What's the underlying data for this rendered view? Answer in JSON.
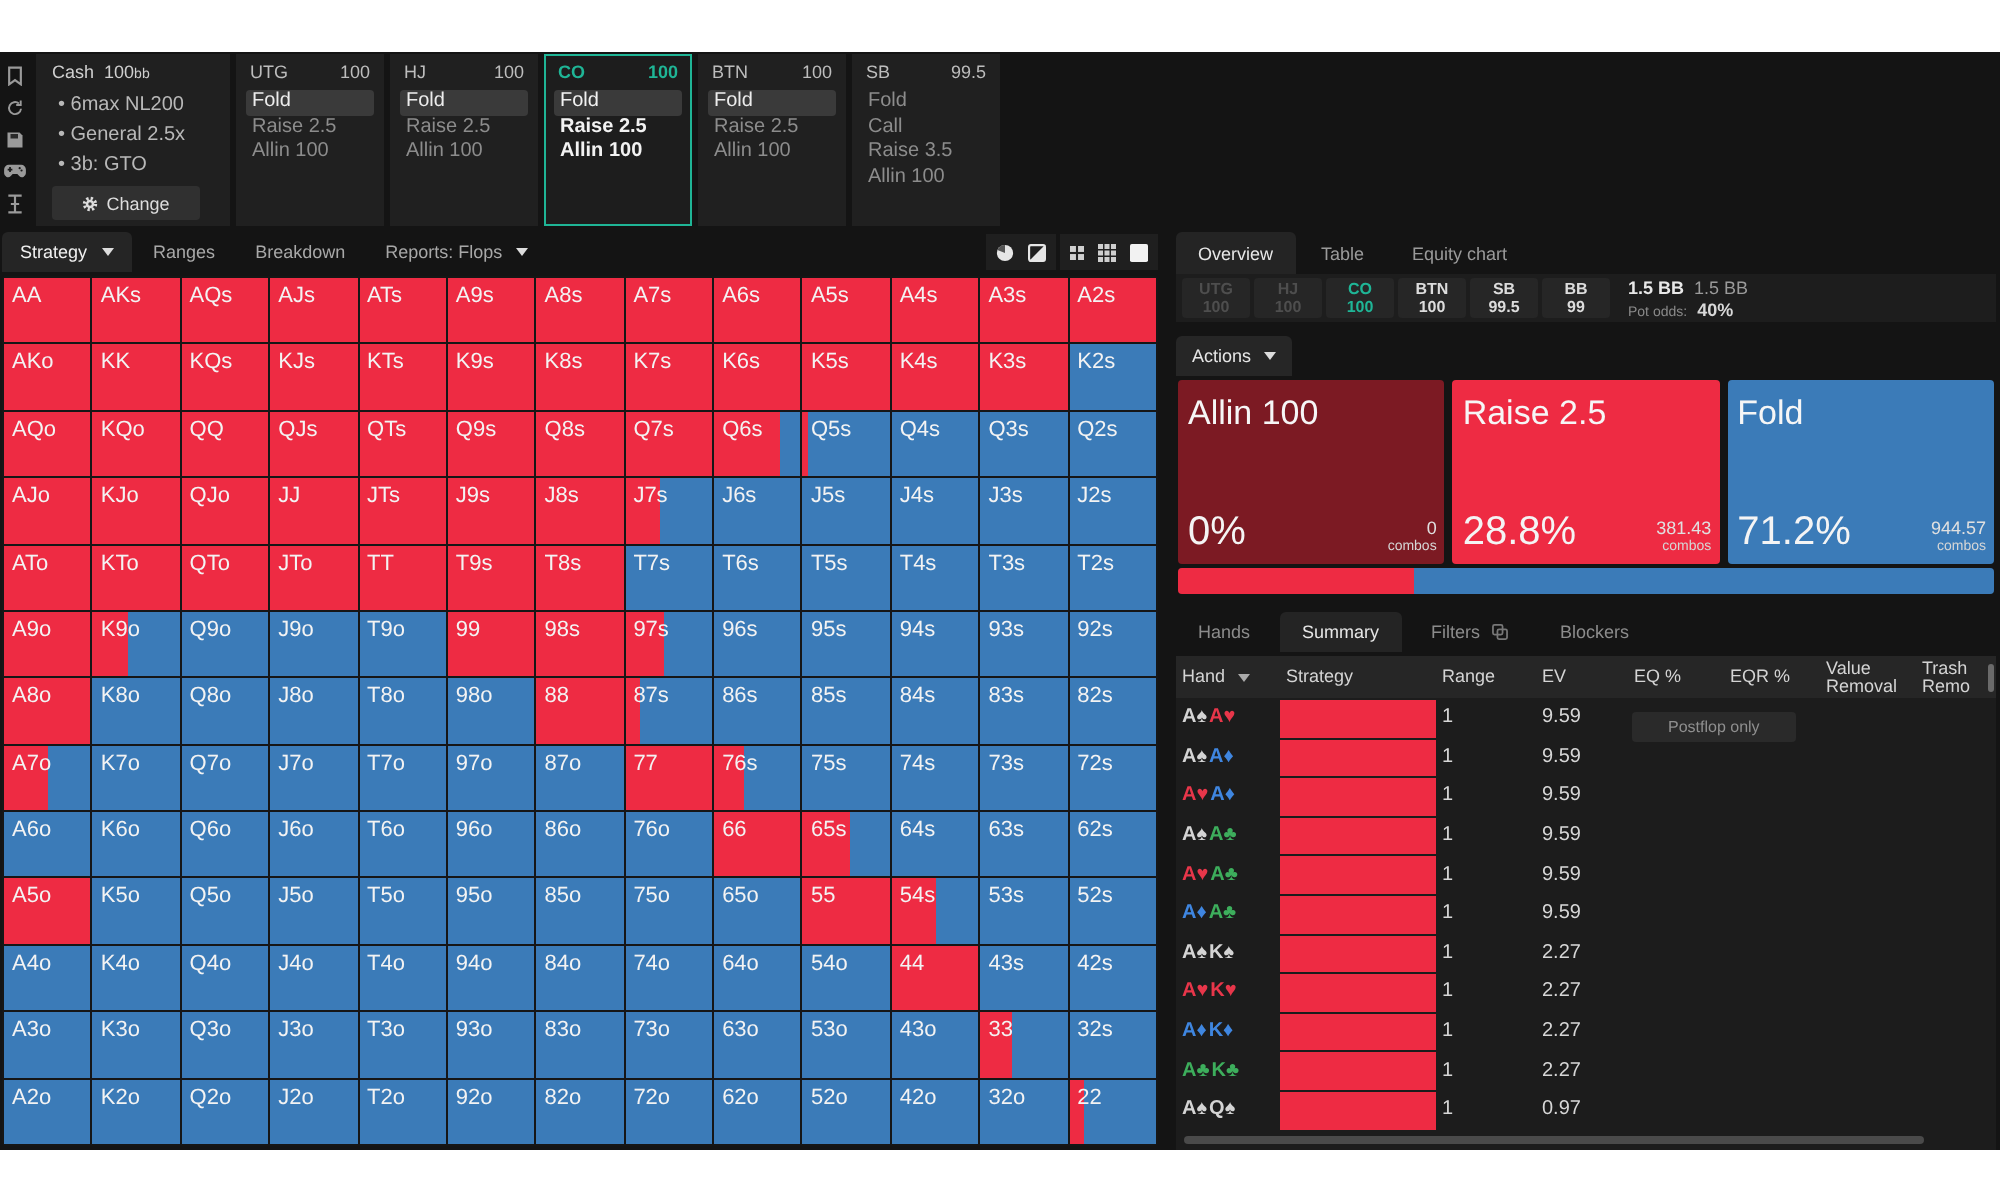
{
  "game": {
    "type": "Cash",
    "stack": "100",
    "unit": "bb",
    "details": [
      "• 6max NL200",
      "• General 2.5x",
      "• 3b: GTO"
    ],
    "button": "Change"
  },
  "positions": [
    {
      "name": "UTG",
      "stack": "100",
      "active": false,
      "actions": [
        {
          "label": "Fold",
          "selected": true
        },
        {
          "label": "Raise 2.5",
          "selected": false
        },
        {
          "label": "Allin 100",
          "selected": false
        }
      ]
    },
    {
      "name": "HJ",
      "stack": "100",
      "active": false,
      "actions": [
        {
          "label": "Fold",
          "selected": true
        },
        {
          "label": "Raise 2.5",
          "selected": false
        },
        {
          "label": "Allin 100",
          "selected": false
        }
      ]
    },
    {
      "name": "CO",
      "stack": "100",
      "active": true,
      "actions": [
        {
          "label": "Fold",
          "selected": true
        },
        {
          "label": "Raise 2.5",
          "selected": false
        },
        {
          "label": "Allin 100",
          "selected": false
        }
      ]
    },
    {
      "name": "BTN",
      "stack": "100",
      "active": false,
      "actions": [
        {
          "label": "Fold",
          "selected": true
        },
        {
          "label": "Raise 2.5",
          "selected": false
        },
        {
          "label": "Allin 100",
          "selected": false
        }
      ]
    },
    {
      "name": "SB",
      "stack": "99.5",
      "active": false,
      "actions": [
        {
          "label": "Fold",
          "selected": false
        },
        {
          "label": "Call",
          "selected": false
        },
        {
          "label": "Raise 3.5",
          "selected": false
        },
        {
          "label": "Allin 100",
          "selected": false
        }
      ]
    }
  ],
  "view_tabs": [
    {
      "label": "Strategy",
      "selected": true,
      "dropdown": true
    },
    {
      "label": "Ranges",
      "selected": false,
      "dropdown": false
    },
    {
      "label": "Breakdown",
      "selected": false,
      "dropdown": false
    },
    {
      "label": "Reports: Flops",
      "selected": false,
      "dropdown": true
    }
  ],
  "grid": {
    "rows": [
      [
        {
          "hand": "AA",
          "kind": "raise"
        },
        {
          "hand": "AKs",
          "kind": "raise"
        },
        {
          "hand": "AQs",
          "kind": "raise"
        },
        {
          "hand": "AJs",
          "kind": "raise"
        },
        {
          "hand": "ATs",
          "kind": "raise"
        },
        {
          "hand": "A9s",
          "kind": "raise"
        },
        {
          "hand": "A8s",
          "kind": "raise"
        },
        {
          "hand": "A7s",
          "kind": "raise"
        },
        {
          "hand": "A6s",
          "kind": "raise"
        },
        {
          "hand": "A5s",
          "kind": "raise"
        },
        {
          "hand": "A4s",
          "kind": "raise"
        },
        {
          "hand": "A3s",
          "kind": "raise"
        },
        {
          "hand": "A2s",
          "kind": "raise"
        }
      ],
      [
        {
          "hand": "AKo",
          "kind": "raise"
        },
        {
          "hand": "KK",
          "kind": "raise"
        },
        {
          "hand": "KQs",
          "kind": "raise"
        },
        {
          "hand": "KJs",
          "kind": "raise"
        },
        {
          "hand": "KTs",
          "kind": "raise"
        },
        {
          "hand": "K9s",
          "kind": "raise"
        },
        {
          "hand": "K8s",
          "kind": "raise"
        },
        {
          "hand": "K7s",
          "kind": "raise"
        },
        {
          "hand": "K6s",
          "kind": "raise"
        },
        {
          "hand": "K5s",
          "kind": "raise"
        },
        {
          "hand": "K4s",
          "kind": "raise"
        },
        {
          "hand": "K3s",
          "kind": "raise"
        },
        {
          "hand": "K2s",
          "kind": "fold"
        }
      ],
      [
        {
          "hand": "AQo",
          "kind": "raise"
        },
        {
          "hand": "KQo",
          "kind": "raise"
        },
        {
          "hand": "QQ",
          "kind": "raise"
        },
        {
          "hand": "QJs",
          "kind": "raise"
        },
        {
          "hand": "QTs",
          "kind": "raise"
        },
        {
          "hand": "Q9s",
          "kind": "raise"
        },
        {
          "hand": "Q8s",
          "kind": "raise"
        },
        {
          "hand": "Q7s",
          "kind": "raise"
        },
        {
          "hand": "Q6s",
          "kind": "mixed",
          "level": 0.75
        },
        {
          "hand": "Q5s",
          "kind": "mixed",
          "level": 0.05
        },
        {
          "hand": "Q4s",
          "kind": "fold"
        },
        {
          "hand": "Q3s",
          "kind": "fold"
        },
        {
          "hand": "Q2s",
          "kind": "fold"
        }
      ],
      [
        {
          "hand": "AJo",
          "kind": "raise"
        },
        {
          "hand": "KJo",
          "kind": "raise"
        },
        {
          "hand": "QJo",
          "kind": "raise"
        },
        {
          "hand": "JJ",
          "kind": "raise"
        },
        {
          "hand": "JTs",
          "kind": "raise"
        },
        {
          "hand": "J9s",
          "kind": "raise"
        },
        {
          "hand": "J8s",
          "kind": "raise"
        },
        {
          "hand": "J7s",
          "kind": "mixed",
          "level": 0.4
        },
        {
          "hand": "J6s",
          "kind": "fold"
        },
        {
          "hand": "J5s",
          "kind": "fold"
        },
        {
          "hand": "J4s",
          "kind": "fold"
        },
        {
          "hand": "J3s",
          "kind": "fold"
        },
        {
          "hand": "J2s",
          "kind": "fold"
        }
      ],
      [
        {
          "hand": "ATo",
          "kind": "raise"
        },
        {
          "hand": "KTo",
          "kind": "raise"
        },
        {
          "hand": "QTo",
          "kind": "raise"
        },
        {
          "hand": "JTo",
          "kind": "raise"
        },
        {
          "hand": "TT",
          "kind": "raise"
        },
        {
          "hand": "T9s",
          "kind": "raise"
        },
        {
          "hand": "T8s",
          "kind": "raise"
        },
        {
          "hand": "T7s",
          "kind": "fold"
        },
        {
          "hand": "T6s",
          "kind": "fold"
        },
        {
          "hand": "T5s",
          "kind": "fold"
        },
        {
          "hand": "T4s",
          "kind": "fold"
        },
        {
          "hand": "T3s",
          "kind": "fold"
        },
        {
          "hand": "T2s",
          "kind": "fold"
        }
      ],
      [
        {
          "hand": "A9o",
          "kind": "raise"
        },
        {
          "hand": "K9o",
          "kind": "mixed",
          "level": 0.4
        },
        {
          "hand": "Q9o",
          "kind": "fold"
        },
        {
          "hand": "J9o",
          "kind": "fold"
        },
        {
          "hand": "T9o",
          "kind": "fold"
        },
        {
          "hand": "99",
          "kind": "raise"
        },
        {
          "hand": "98s",
          "kind": "raise"
        },
        {
          "hand": "97s",
          "kind": "mixed",
          "level": 0.45
        },
        {
          "hand": "96s",
          "kind": "fold"
        },
        {
          "hand": "95s",
          "kind": "fold"
        },
        {
          "hand": "94s",
          "kind": "fold"
        },
        {
          "hand": "93s",
          "kind": "fold"
        },
        {
          "hand": "92s",
          "kind": "fold"
        }
      ],
      [
        {
          "hand": "A8o",
          "kind": "raise"
        },
        {
          "hand": "K8o",
          "kind": "fold"
        },
        {
          "hand": "Q8o",
          "kind": "fold"
        },
        {
          "hand": "J8o",
          "kind": "fold"
        },
        {
          "hand": "T8o",
          "kind": "fold"
        },
        {
          "hand": "98o",
          "kind": "fold"
        },
        {
          "hand": "88",
          "kind": "raise"
        },
        {
          "hand": "87s",
          "kind": "mixed",
          "level": 0.17
        },
        {
          "hand": "86s",
          "kind": "fold"
        },
        {
          "hand": "85s",
          "kind": "fold"
        },
        {
          "hand": "84s",
          "kind": "fold"
        },
        {
          "hand": "83s",
          "kind": "fold"
        },
        {
          "hand": "82s",
          "kind": "fold"
        }
      ],
      [
        {
          "hand": "A7o",
          "kind": "mixed",
          "level": 0.5
        },
        {
          "hand": "K7o",
          "kind": "fold"
        },
        {
          "hand": "Q7o",
          "kind": "fold"
        },
        {
          "hand": "J7o",
          "kind": "fold"
        },
        {
          "hand": "T7o",
          "kind": "fold"
        },
        {
          "hand": "97o",
          "kind": "fold"
        },
        {
          "hand": "87o",
          "kind": "fold"
        },
        {
          "hand": "77",
          "kind": "raise"
        },
        {
          "hand": "76s",
          "kind": "mixed",
          "level": 0.35
        },
        {
          "hand": "75s",
          "kind": "fold"
        },
        {
          "hand": "74s",
          "kind": "fold"
        },
        {
          "hand": "73s",
          "kind": "fold"
        },
        {
          "hand": "72s",
          "kind": "fold"
        }
      ],
      [
        {
          "hand": "A6o",
          "kind": "fold"
        },
        {
          "hand": "K6o",
          "kind": "fold"
        },
        {
          "hand": "Q6o",
          "kind": "fold"
        },
        {
          "hand": "J6o",
          "kind": "fold"
        },
        {
          "hand": "T6o",
          "kind": "fold"
        },
        {
          "hand": "96o",
          "kind": "fold"
        },
        {
          "hand": "86o",
          "kind": "fold"
        },
        {
          "hand": "76o",
          "kind": "fold"
        },
        {
          "hand": "66",
          "kind": "raise"
        },
        {
          "hand": "65s",
          "kind": "mixed",
          "level": 0.55
        },
        {
          "hand": "64s",
          "kind": "fold"
        },
        {
          "hand": "63s",
          "kind": "fold"
        },
        {
          "hand": "62s",
          "kind": "fold"
        }
      ],
      [
        {
          "hand": "A5o",
          "kind": "raise"
        },
        {
          "hand": "K5o",
          "kind": "fold"
        },
        {
          "hand": "Q5o",
          "kind": "fold"
        },
        {
          "hand": "J5o",
          "kind": "fold"
        },
        {
          "hand": "T5o",
          "kind": "fold"
        },
        {
          "hand": "95o",
          "kind": "fold"
        },
        {
          "hand": "85o",
          "kind": "fold"
        },
        {
          "hand": "75o",
          "kind": "fold"
        },
        {
          "hand": "65o",
          "kind": "fold"
        },
        {
          "hand": "55",
          "kind": "raise"
        },
        {
          "hand": "54s",
          "kind": "mixed",
          "level": 0.5
        },
        {
          "hand": "53s",
          "kind": "fold"
        },
        {
          "hand": "52s",
          "kind": "fold"
        }
      ],
      [
        {
          "hand": "A4o",
          "kind": "fold"
        },
        {
          "hand": "K4o",
          "kind": "fold"
        },
        {
          "hand": "Q4o",
          "kind": "fold"
        },
        {
          "hand": "J4o",
          "kind": "fold"
        },
        {
          "hand": "T4o",
          "kind": "fold"
        },
        {
          "hand": "94o",
          "kind": "fold"
        },
        {
          "hand": "84o",
          "kind": "fold"
        },
        {
          "hand": "74o",
          "kind": "fold"
        },
        {
          "hand": "64o",
          "kind": "fold"
        },
        {
          "hand": "54o",
          "kind": "fold"
        },
        {
          "hand": "44",
          "kind": "raise"
        },
        {
          "hand": "43s",
          "kind": "fold"
        },
        {
          "hand": "42s",
          "kind": "fold"
        }
      ],
      [
        {
          "hand": "A3o",
          "kind": "fold"
        },
        {
          "hand": "K3o",
          "kind": "fold"
        },
        {
          "hand": "Q3o",
          "kind": "fold"
        },
        {
          "hand": "J3o",
          "kind": "fold"
        },
        {
          "hand": "T3o",
          "kind": "fold"
        },
        {
          "hand": "93o",
          "kind": "fold"
        },
        {
          "hand": "83o",
          "kind": "fold"
        },
        {
          "hand": "73o",
          "kind": "fold"
        },
        {
          "hand": "63o",
          "kind": "fold"
        },
        {
          "hand": "53o",
          "kind": "fold"
        },
        {
          "hand": "43o",
          "kind": "fold"
        },
        {
          "hand": "33",
          "kind": "mixed",
          "level": 0.37
        },
        {
          "hand": "32s",
          "kind": "fold"
        }
      ],
      [
        {
          "hand": "A2o",
          "kind": "fold"
        },
        {
          "hand": "K2o",
          "kind": "fold"
        },
        {
          "hand": "Q2o",
          "kind": "fold"
        },
        {
          "hand": "J2o",
          "kind": "fold"
        },
        {
          "hand": "T2o",
          "kind": "fold"
        },
        {
          "hand": "92o",
          "kind": "fold"
        },
        {
          "hand": "82o",
          "kind": "fold"
        },
        {
          "hand": "72o",
          "kind": "fold"
        },
        {
          "hand": "62o",
          "kind": "fold"
        },
        {
          "hand": "52o",
          "kind": "fold"
        },
        {
          "hand": "42o",
          "kind": "fold"
        },
        {
          "hand": "32o",
          "kind": "fold"
        },
        {
          "hand": "22",
          "kind": "mixed",
          "level": 0.16
        }
      ]
    ]
  },
  "panel_tabs": [
    {
      "label": "Overview",
      "selected": true
    },
    {
      "label": "Table",
      "selected": false
    },
    {
      "label": "Equity chart",
      "selected": false
    }
  ],
  "seats": [
    {
      "name": "UTG",
      "stack": "100",
      "folded": true,
      "active": false
    },
    {
      "name": "HJ",
      "stack": "100",
      "folded": true,
      "active": false
    },
    {
      "name": "CO",
      "stack": "100",
      "folded": false,
      "active": true
    },
    {
      "name": "BTN",
      "stack": "100",
      "folded": false,
      "active": false
    },
    {
      "name": "SB",
      "stack": "99.5",
      "folded": false,
      "active": false
    },
    {
      "name": "BB",
      "stack": "99",
      "folded": false,
      "active": false
    }
  ],
  "pot": {
    "amount": "1.5 BB",
    "amount_2": "1.5 BB",
    "odds_label": "Pot odds:",
    "odds": "40%"
  },
  "actions_menu": {
    "label": "Actions"
  },
  "actions": [
    {
      "label": "Allin 100",
      "percent": "0%",
      "combos": "0",
      "unit": "combos",
      "color": "#7c1a23"
    },
    {
      "label": "Raise 2.5",
      "percent": "28.8%",
      "combos": "381.43",
      "unit": "combos",
      "color": "#ee2b43"
    },
    {
      "label": "Fold",
      "percent": "71.2%",
      "combos": "944.57",
      "unit": "combos",
      "color": "#3b7bb8"
    }
  ],
  "frequency_bar": {
    "segments": [
      {
        "color": "#ee2b43",
        "level": 0.288
      },
      {
        "color": "#3b7bb8",
        "level": 0.712
      }
    ]
  },
  "hand_tabs": [
    {
      "label": "Hands",
      "selected": false,
      "icon": false
    },
    {
      "label": "Summary",
      "selected": true,
      "icon": false
    },
    {
      "label": "Filters",
      "selected": false,
      "icon": true
    },
    {
      "label": "Blockers",
      "selected": false,
      "icon": false
    }
  ],
  "table": {
    "columns": [
      {
        "label": "Hand",
        "dropdown": true
      },
      {
        "label": "Strategy",
        "dropdown": false
      },
      {
        "label": "Range",
        "dropdown": false
      },
      {
        "label": "EV",
        "dropdown": false
      },
      {
        "label": "EQ %",
        "dropdown": false
      },
      {
        "label": "EQR %",
        "dropdown": false
      },
      {
        "label": "Value Removal",
        "dropdown": false
      },
      {
        "label": "Trash Remo",
        "dropdown": false
      }
    ],
    "note": "Postflop only",
    "rows": [
      {
        "cards": [
          {
            "label": "A♠",
            "color": "#d4d4d4"
          },
          {
            "label": "A♥",
            "color": "#e8364a"
          }
        ],
        "level": 1,
        "range": "1",
        "ev": "9.59"
      },
      {
        "cards": [
          {
            "label": "A♠",
            "color": "#d4d4d4"
          },
          {
            "label": "A♦",
            "color": "#3f86e0"
          }
        ],
        "level": 1,
        "range": "1",
        "ev": "9.59"
      },
      {
        "cards": [
          {
            "label": "A♥",
            "color": "#e8364a"
          },
          {
            "label": "A♦",
            "color": "#3f86e0"
          }
        ],
        "level": 1,
        "range": "1",
        "ev": "9.59"
      },
      {
        "cards": [
          {
            "label": "A♠",
            "color": "#d4d4d4"
          },
          {
            "label": "A♣",
            "color": "#3dae5c"
          }
        ],
        "level": 1,
        "range": "1",
        "ev": "9.59"
      },
      {
        "cards": [
          {
            "label": "A♥",
            "color": "#e8364a"
          },
          {
            "label": "A♣",
            "color": "#3dae5c"
          }
        ],
        "level": 1,
        "range": "1",
        "ev": "9.59"
      },
      {
        "cards": [
          {
            "label": "A♦",
            "color": "#3f86e0"
          },
          {
            "label": "A♣",
            "color": "#3dae5c"
          }
        ],
        "level": 1,
        "range": "1",
        "ev": "9.59"
      },
      {
        "cards": [
          {
            "label": "A♠",
            "color": "#d4d4d4"
          },
          {
            "label": "K♠",
            "color": "#d4d4d4"
          }
        ],
        "level": 1,
        "range": "1",
        "ev": "2.27"
      },
      {
        "cards": [
          {
            "label": "A♥",
            "color": "#e8364a"
          },
          {
            "label": "K♥",
            "color": "#e8364a"
          }
        ],
        "level": 1,
        "range": "1",
        "ev": "2.27"
      },
      {
        "cards": [
          {
            "label": "A♦",
            "color": "#3f86e0"
          },
          {
            "label": "K♦",
            "color": "#3f86e0"
          }
        ],
        "level": 1,
        "range": "1",
        "ev": "2.27"
      },
      {
        "cards": [
          {
            "label": "A♣",
            "color": "#3dae5c"
          },
          {
            "label": "K♣",
            "color": "#3dae5c"
          }
        ],
        "level": 1,
        "range": "1",
        "ev": "2.27"
      },
      {
        "cards": [
          {
            "label": "A♠",
            "color": "#d4d4d4"
          },
          {
            "label": "Q♠",
            "color": "#d4d4d4"
          }
        ],
        "level": 1,
        "range": "1",
        "ev": "0.97"
      }
    ]
  }
}
